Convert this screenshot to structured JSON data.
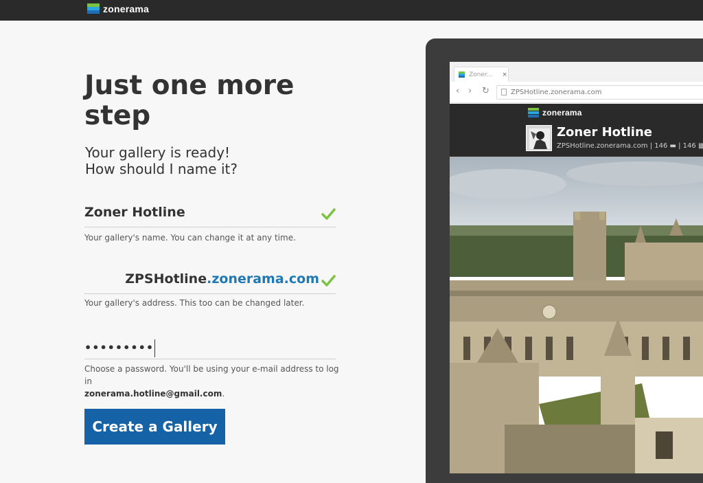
{
  "topbar": {
    "logo_text": "zonerama"
  },
  "form": {
    "heading": "Just one more step",
    "subtitle_line1": "Your gallery is ready!",
    "subtitle_line2": "How should I name it?",
    "name_value": "Zoner Hotline",
    "name_hint": "Your gallery's name. You can change it at any time.",
    "address_user": "ZPSHotline",
    "address_domain": ".zonerama.com",
    "address_hint": "Your gallery's address. This too can be changed later.",
    "password_value": "•••••••••",
    "password_hint_prefix": "Choose a password. You'll be using your e-mail address to log in",
    "password_hint_email": "zonerama.hotline@gmail.com",
    "password_hint_suffix": ".",
    "submit_label": "Create a Gallery"
  },
  "preview": {
    "tab_label": "Zoner...",
    "tab_close": "×",
    "url": "ZPSHotline.zonerama.com",
    "logo_text": "zonerama",
    "gallery_title": "Zoner Hotline",
    "gallery_meta": "ZPSHotline.zonerama.com | 146 ▬ | 146 ▦"
  },
  "colors": {
    "accent_blue": "#1562a7",
    "domain_blue": "#1f78b4",
    "check_green": "#7cc242",
    "topbar": "#2a2a2a"
  },
  "icons": {
    "valid": "check-icon",
    "back": "back-arrow-icon",
    "forward": "forward-arrow-icon",
    "reload": "reload-icon"
  }
}
